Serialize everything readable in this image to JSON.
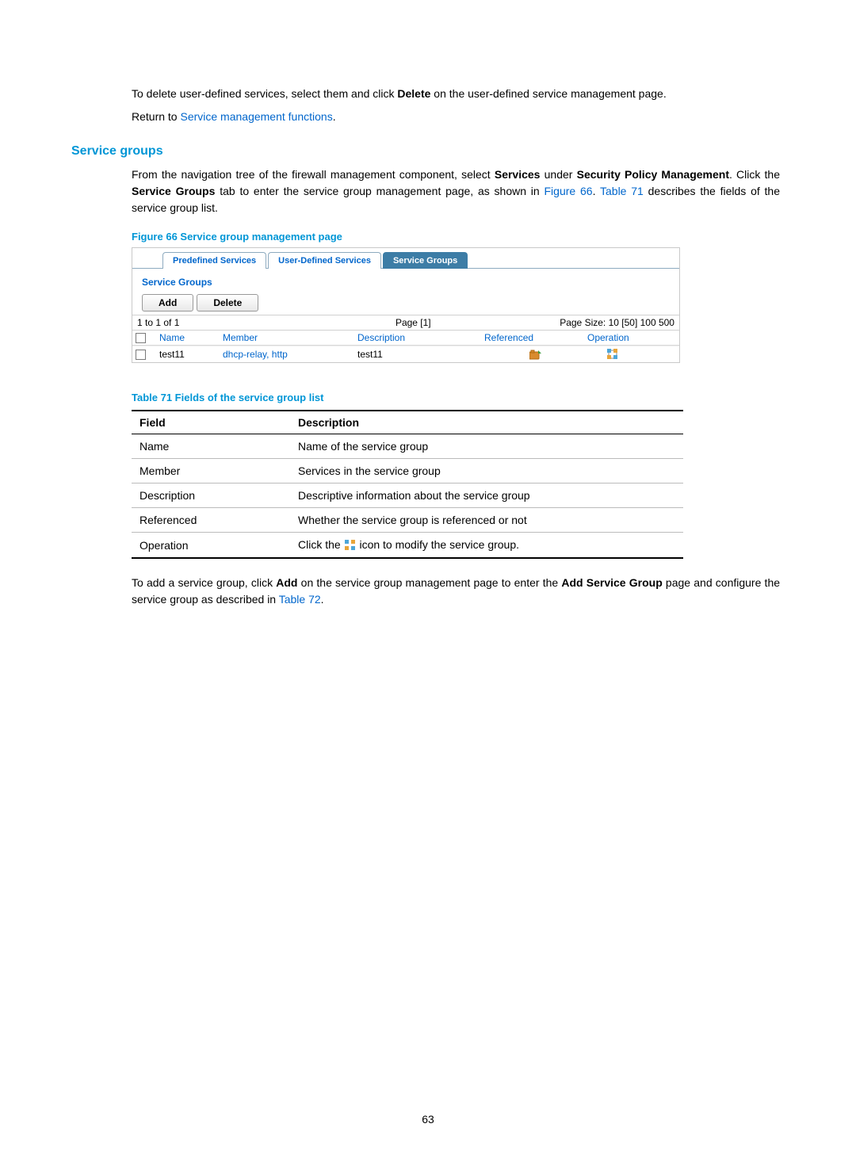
{
  "intro": {
    "para1_prefix": "To delete user-defined services, select them and click ",
    "para1_bold": "Delete",
    "para1_suffix": " on the user-defined service management page.",
    "return_prefix": "Return to ",
    "return_link": "Service management functions",
    "return_suffix": "."
  },
  "section_heading": "Service groups",
  "para2": {
    "prefix": "From the navigation tree of the firewall management component, select ",
    "b1": "Services",
    "mid1": " under ",
    "b2": "Security Policy Management",
    "mid2": ". Click the ",
    "b3": "Service Groups",
    "mid3": " tab to enter the service group management page, as shown in ",
    "link1": "Figure 66",
    "mid4": ". ",
    "link2": "Table 71",
    "suffix": " describes the fields of the service group list."
  },
  "figure_caption": "Figure 66 Service group management page",
  "screenshot": {
    "tabs": {
      "predefined": "Predefined Services",
      "userdefined": "User-Defined Services",
      "servicegroups": "Service Groups"
    },
    "panel_title": "Service Groups",
    "buttons": {
      "add": "Add",
      "delete": "Delete"
    },
    "pager": {
      "range": "1 to 1 of 1",
      "page_label": "Page [1]",
      "size_label": "Page Size: 10 [50] 100 500"
    },
    "columns": {
      "name": "Name",
      "member": "Member",
      "description": "Description",
      "referenced": "Referenced",
      "operation": "Operation"
    },
    "row": {
      "name": "test11",
      "member": "dhcp-relay, http",
      "description": "test11"
    }
  },
  "table_caption": "Table 71 Fields of the service group list",
  "fields_table": {
    "header": {
      "field": "Field",
      "desc": "Description"
    },
    "rows": [
      {
        "field": "Name",
        "desc": "Name of the service group"
      },
      {
        "field": "Member",
        "desc": "Services in the service group"
      },
      {
        "field": "Description",
        "desc": "Descriptive information about the service group"
      },
      {
        "field": "Referenced",
        "desc": "Whether the service group is referenced or not"
      },
      {
        "field": "Operation",
        "desc_prefix": "Click the ",
        "desc_suffix": " icon to modify the service group."
      }
    ]
  },
  "para3": {
    "prefix": "To add a service group, click ",
    "b1": "Add",
    "mid1": " on the service group management page to enter the ",
    "b2": "Add Service Group",
    "mid2": " page and configure the service group as described in ",
    "link": "Table 72",
    "suffix": "."
  },
  "page_number": "63"
}
